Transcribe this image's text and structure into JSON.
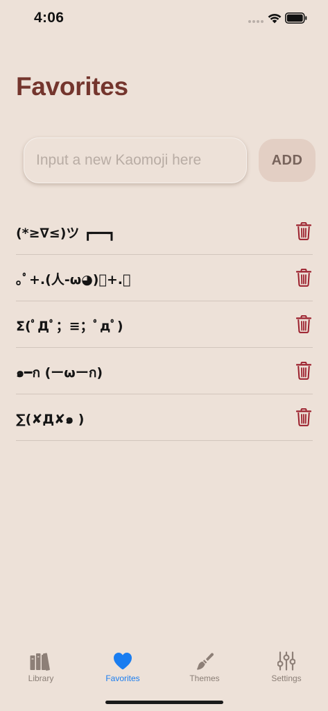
{
  "status_bar": {
    "time": "4:06"
  },
  "page": {
    "title": "Favorites"
  },
  "input": {
    "placeholder": "Input a new Kaomoji here",
    "value": ""
  },
  "add_button": {
    "label": "ADD"
  },
  "favorites": [
    {
      "kaomoji": "(*≥∇≤)ツ ┏━━┓"
    },
    {
      "kaomoji": "｡ﾟ+.(人-ω◕)ﾟ+.ﾟ"
    },
    {
      "kaomoji": "Σ(ﾟДﾟ；≡；ﾟдﾟ)"
    },
    {
      "kaomoji": "๑━ก (ーωーก)"
    },
    {
      "kaomoji": "∑(✘Д✘๑ )"
    }
  ],
  "tab_bar": {
    "tabs": [
      {
        "label": "Library",
        "icon": "books-icon"
      },
      {
        "label": "Favorites",
        "icon": "heart-icon"
      },
      {
        "label": "Themes",
        "icon": "paintbrush-icon"
      },
      {
        "label": "Settings",
        "icon": "sliders-icon"
      }
    ],
    "active_index": 1
  },
  "colors": {
    "background": "#ede1d8",
    "title": "#74352d",
    "delete_icon": "#9b1f2c",
    "active_tab": "#1a7df0",
    "inactive_tab": "#8a7e76"
  }
}
